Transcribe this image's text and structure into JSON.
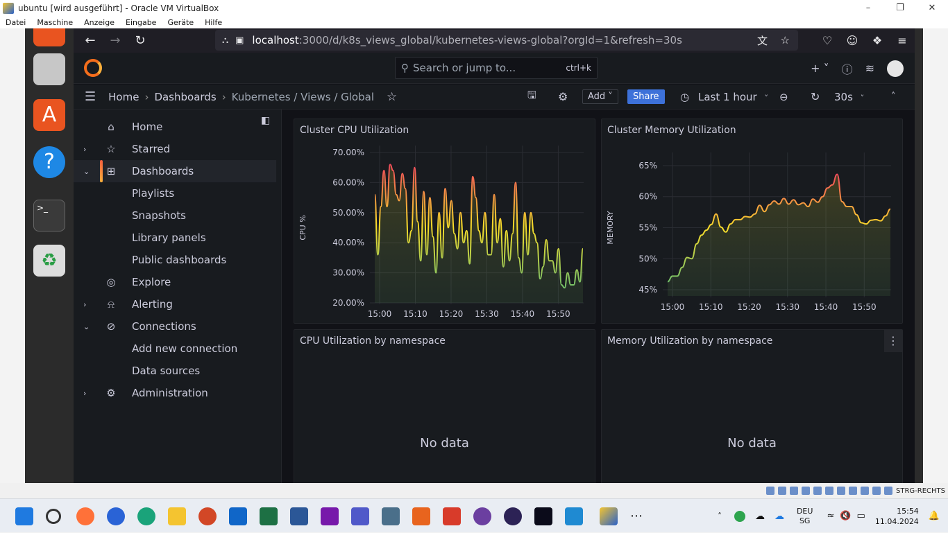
{
  "window": {
    "title": "ubuntu [wird ausgeführt] - Oracle VM VirtualBox",
    "menu": [
      "Datei",
      "Maschine",
      "Anzeige",
      "Eingabe",
      "Geräte",
      "Hilfe"
    ]
  },
  "browser": {
    "url_host": "localhost",
    "url_rest": ":3000/d/k8s_views_global/kubernetes-views-global?orgId=1&refresh=30s"
  },
  "grafana": {
    "search_placeholder": "Search or jump to...",
    "search_shortcut": "ctrl+k",
    "breadcrumb": {
      "home": "Home",
      "dashboards": "Dashboards",
      "current": "Kubernetes / Views / Global"
    },
    "toolbar": {
      "add": "Add",
      "share": "Share",
      "time_range": "Last 1 hour",
      "refresh": "30s"
    },
    "sidebar": [
      {
        "label": "Home",
        "icon": "home-icon",
        "chevron": ""
      },
      {
        "label": "Starred",
        "icon": "star-icon",
        "chevron": "›"
      },
      {
        "label": "Dashboards",
        "icon": "dashboards-icon",
        "chevron": "⌄",
        "active": true
      },
      {
        "label": "Playlists",
        "icon": "",
        "chevron": ""
      },
      {
        "label": "Snapshots",
        "icon": "",
        "chevron": ""
      },
      {
        "label": "Library panels",
        "icon": "",
        "chevron": ""
      },
      {
        "label": "Public dashboards",
        "icon": "",
        "chevron": ""
      },
      {
        "label": "Explore",
        "icon": "compass-icon",
        "chevron": ""
      },
      {
        "label": "Alerting",
        "icon": "bell-icon",
        "chevron": "›"
      },
      {
        "label": "Connections",
        "icon": "connections-icon",
        "chevron": "⌄"
      },
      {
        "label": "Add new connection",
        "icon": "",
        "chevron": ""
      },
      {
        "label": "Data sources",
        "icon": "",
        "chevron": ""
      },
      {
        "label": "Administration",
        "icon": "gear-icon",
        "chevron": "›"
      }
    ],
    "panels": {
      "cpu": {
        "title": "Cluster CPU Utilization",
        "nodata": ""
      },
      "mem": {
        "title": "Cluster Memory Utilization",
        "nodata": ""
      },
      "cpu_ns": {
        "title": "CPU Utilization by namespace",
        "nodata": "No data"
      },
      "mem_ns": {
        "title": "Memory Utilization by namespace",
        "nodata": "No data"
      }
    }
  },
  "chart_data": [
    {
      "type": "line",
      "title": "Cluster CPU Utilization",
      "ylabel": "CPU %",
      "ylim": [
        20,
        70
      ],
      "yticks": [
        "70.00%",
        "60.00%",
        "50.00%",
        "40.00%",
        "30.00%",
        "20.00%"
      ],
      "xticks": [
        "15:00",
        "15:10",
        "15:20",
        "15:30",
        "15:40",
        "15:50"
      ],
      "values": [
        56,
        36,
        52,
        64,
        52,
        66,
        64,
        56,
        54,
        63,
        58,
        40,
        44,
        65,
        47,
        34,
        57,
        36,
        55,
        42,
        30,
        50,
        35,
        58,
        45,
        54,
        43,
        38,
        50,
        40,
        44,
        33,
        62,
        55,
        44,
        40,
        50,
        36,
        36,
        56,
        40,
        48,
        32,
        44,
        34,
        43,
        60,
        35,
        30,
        50,
        36,
        50,
        43,
        40,
        28,
        32,
        41,
        34,
        34,
        30,
        38,
        26,
        25,
        30,
        26,
        26,
        31,
        27,
        38
      ]
    },
    {
      "type": "line",
      "title": "Cluster Memory Utilization",
      "ylabel": "MEMORY",
      "ylim": [
        44,
        66
      ],
      "yticks": [
        "65%",
        "60%",
        "55%",
        "50%",
        "45%"
      ],
      "xticks": [
        "15:00",
        "15:10",
        "15:20",
        "15:30",
        "15:40",
        "15:50"
      ],
      "values": [
        46.3,
        47.2,
        47.2,
        48.6,
        50.2,
        50.0,
        52.4,
        53.8,
        54.6,
        55.5,
        57.2,
        55.1,
        54.3,
        55.6,
        56.3,
        56.3,
        56.8,
        56.7,
        57.2,
        58.6,
        57.6,
        58.7,
        59.3,
        58.8,
        59.7,
        58.8,
        59.5,
        58.7,
        59.0,
        58.4,
        59.6,
        59.1,
        60.0,
        61.4,
        61.9,
        63.6,
        59.2,
        58.4,
        58.4,
        57.1,
        55.8,
        55.6,
        56.2,
        56.3,
        56.1,
        56.9,
        58.0
      ]
    }
  ],
  "taskbar": {
    "lang": "DEU",
    "region": "SG",
    "time": "15:54",
    "date": "11.04.2024",
    "status_right": "STRG-RECHTS"
  }
}
